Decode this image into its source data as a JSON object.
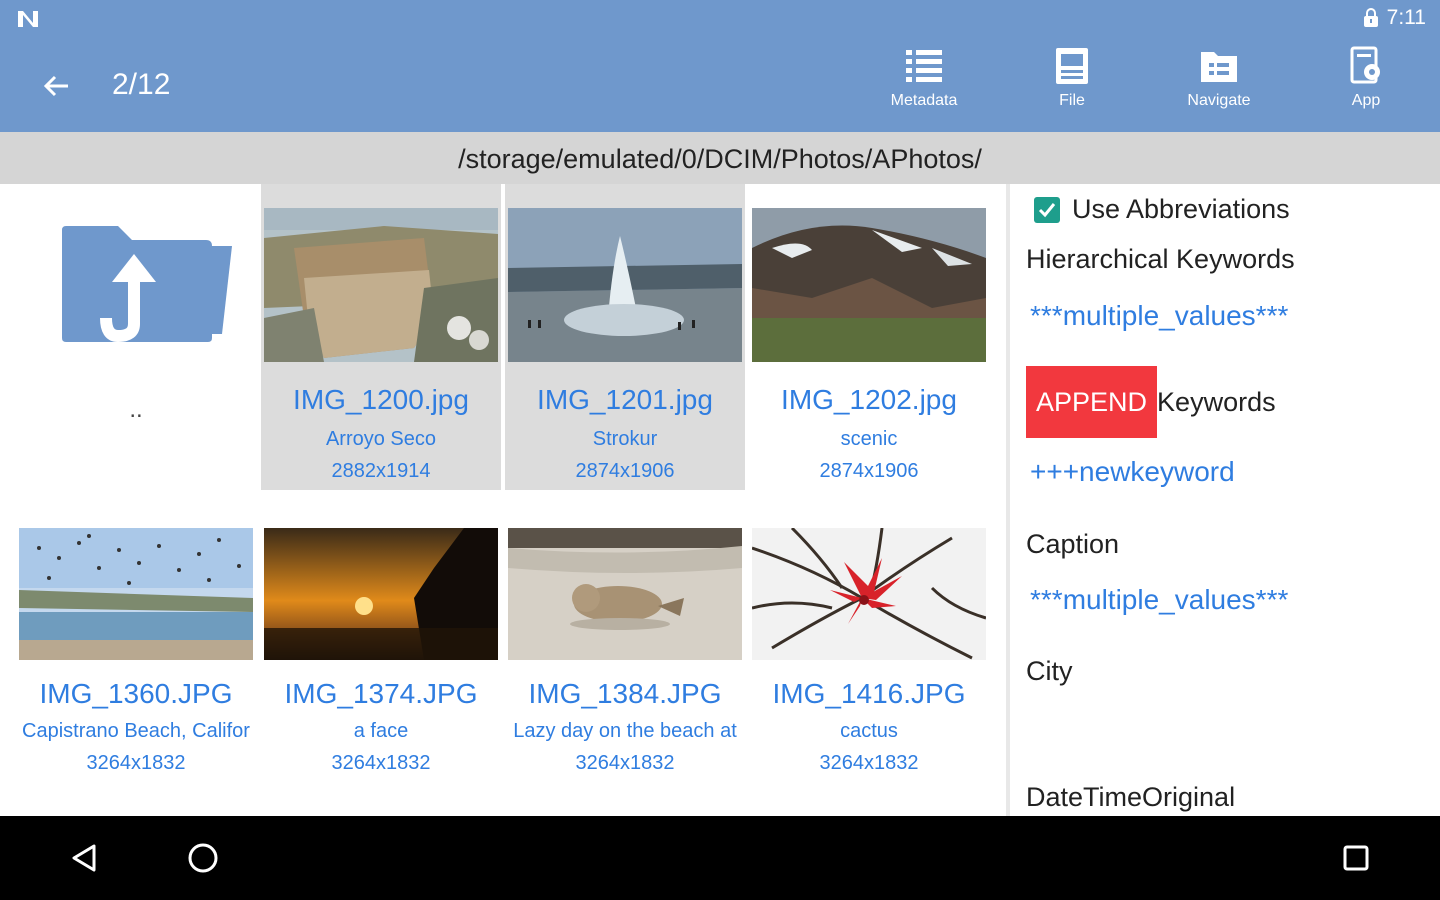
{
  "status_bar": {
    "time": "7:11"
  },
  "app_bar": {
    "counter": "2/12",
    "actions": [
      {
        "label": "Metadata",
        "icon": "list-icon"
      },
      {
        "label": "File",
        "icon": "file-icon"
      },
      {
        "label": "Navigate",
        "icon": "folder-navigate-icon"
      },
      {
        "label": "App",
        "icon": "app-settings-icon"
      }
    ]
  },
  "path": "/storage/emulated/0/DCIM/Photos/APhotos/",
  "parent_folder": {
    "label": "..",
    "icon": "folder-up-icon"
  },
  "photos": [
    {
      "name": "IMG_1200.jpg",
      "desc": "Arroyo Seco",
      "dims": "2882x1914",
      "selected": true
    },
    {
      "name": "IMG_1201.jpg",
      "desc": "Strokur",
      "dims": "2874x1906",
      "selected": true
    },
    {
      "name": "IMG_1202.jpg",
      "desc": "scenic",
      "dims": "2874x1906",
      "selected": false
    },
    {
      "name": "IMG_1360.JPG",
      "desc": "Capistrano Beach, Califor",
      "dims": "3264x1832",
      "selected": false
    },
    {
      "name": "IMG_1374.JPG",
      "desc": "a face",
      "dims": "3264x1832",
      "selected": false
    },
    {
      "name": "IMG_1384.JPG",
      "desc": "Lazy day on the beach at",
      "dims": "3264x1832",
      "selected": false
    },
    {
      "name": "IMG_1416.JPG",
      "desc": "cactus",
      "dims": "3264x1832",
      "selected": false
    }
  ],
  "side_panel": {
    "use_abbreviations": {
      "label": "Use Abbreviations",
      "checked": true
    },
    "hierarchical_keywords": {
      "label": "Hierarchical Keywords",
      "value": "***multiple_values***"
    },
    "keywords": {
      "mode_button": "APPEND",
      "label": "Keywords",
      "value": "+++newkeyword"
    },
    "caption": {
      "label": "Caption",
      "value": "***multiple_values***"
    },
    "city": {
      "label": "City",
      "value": ""
    },
    "datetime": {
      "label": "DateTimeOriginal"
    }
  },
  "colors": {
    "app_bar": "#6f98cc",
    "link_blue": "#2f7de0",
    "append_red": "#f2383e",
    "checkbox_teal": "#1e9e8c",
    "path_bar": "#d5d5d5"
  }
}
